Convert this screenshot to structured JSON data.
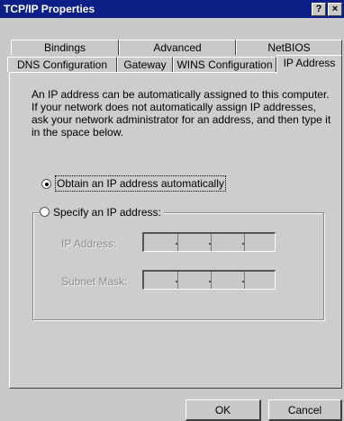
{
  "window": {
    "title": "TCP/IP Properties",
    "help_label": "?",
    "close_label": "×"
  },
  "tabs": {
    "row1": [
      {
        "label": "Bindings"
      },
      {
        "label": "Advanced"
      },
      {
        "label": "NetBIOS"
      }
    ],
    "row2": [
      {
        "label": "DNS Configuration"
      },
      {
        "label": "Gateway"
      },
      {
        "label": "WINS Configuration"
      },
      {
        "label": "IP Address",
        "selected": true
      }
    ]
  },
  "ip_address_tab": {
    "description": "An IP address can be automatically assigned to this computer. If your network does not automatically assign IP addresses, ask your network administrator for an address, and then type it in the space below.",
    "obtain_auto_label": "Obtain an IP address automatically",
    "obtain_auto_selected": true,
    "specify_label": "Specify an IP address:",
    "specify_selected": false,
    "ip_address_label": "IP Address:",
    "ip_address_value": [
      "",
      "",
      "",
      ""
    ],
    "subnet_mask_label": "Subnet Mask:",
    "subnet_mask_value": [
      "",
      "",
      "",
      ""
    ]
  },
  "buttons": {
    "ok_label": "OK",
    "cancel_label": "Cancel"
  }
}
